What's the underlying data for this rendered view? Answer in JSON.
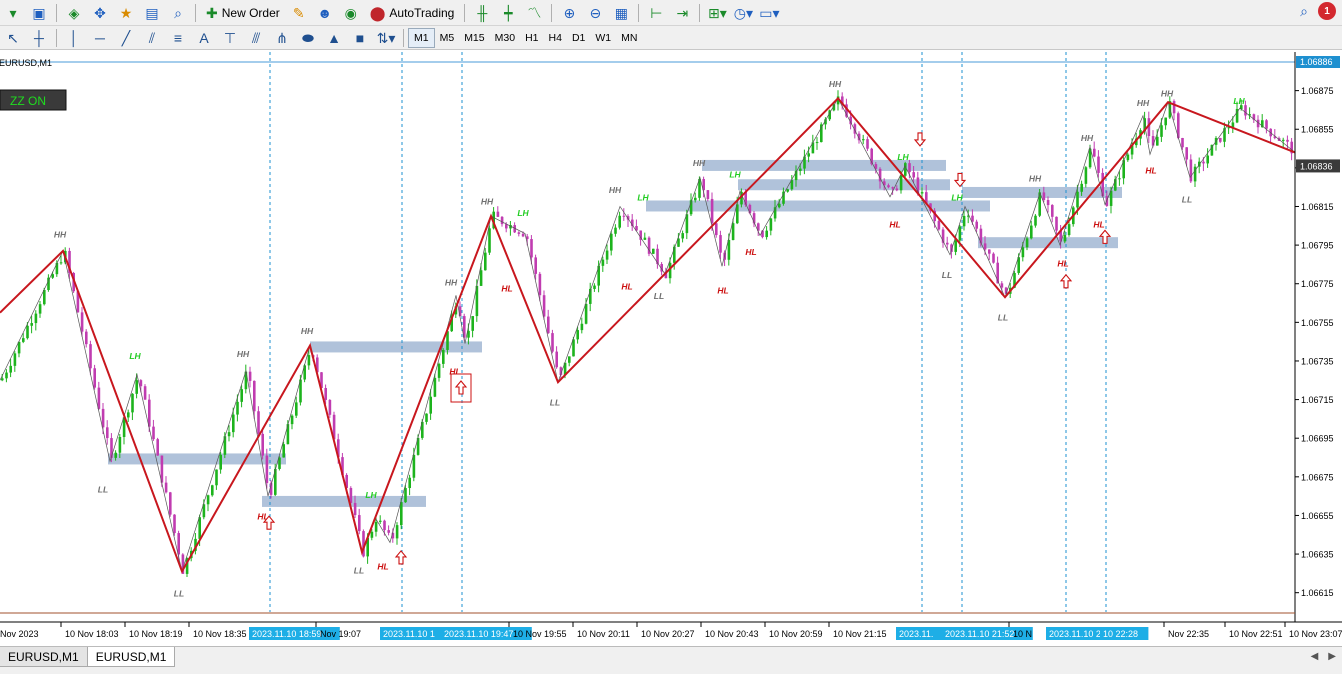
{
  "toolbar": {
    "new_order_label": "New Order",
    "autotrading_label": "AutoTrading",
    "timeframes": [
      "M1",
      "M5",
      "M15",
      "M30",
      "H1",
      "H4",
      "D1",
      "W1",
      "MN"
    ],
    "active_timeframe": "M1",
    "notification_count": "1"
  },
  "chart": {
    "symbol_label": "EURUSD,M1",
    "zz_button_label": "ZZ ON",
    "current_price_label": "1.06836",
    "top_price_label": "1.06886",
    "colors": {
      "bull": "#1db31d",
      "bear": "#c03cb0",
      "zigzag": "#c8171e",
      "zone": "#a7bbd6",
      "vline": "#1e90d0",
      "hh": "#707070",
      "lh": "#22cc22",
      "hl": "#cc1111",
      "ll": "#707070"
    }
  },
  "chart_data": {
    "type": "line",
    "price_scale": {
      "min": 1.06605,
      "max": 1.06895,
      "ticks": [
        "1.06875",
        "1.06855",
        "1.06835",
        "1.06815",
        "1.06795",
        "1.06775",
        "1.06755",
        "1.06735",
        "1.06715",
        "1.06695",
        "1.06675",
        "1.06655",
        "1.06635",
        "1.06615"
      ]
    },
    "time_labels": [
      {
        "text": "Nov 2023",
        "highlighted": false,
        "i": 0
      },
      {
        "text": "10 Nov 18:03",
        "highlighted": false,
        "i": 65
      },
      {
        "text": "10 Nov 18:19",
        "highlighted": false,
        "i": 129
      },
      {
        "text": "10 Nov 18:35",
        "highlighted": false,
        "i": 193
      },
      {
        "text": "2023.11.10 18:59",
        "highlighted": true,
        "i": 252
      },
      {
        "text": "Nov 19:07",
        "highlighted": false,
        "i": 320
      },
      {
        "text": "2023.11.10 1",
        "highlighted": true,
        "i": 383
      },
      {
        "text": "2023.11.10 19:47",
        "highlighted": true,
        "i": 444
      },
      {
        "text": "10 Nov 19:55",
        "highlighted": false,
        "i": 513
      },
      {
        "text": "10 Nov 20:11",
        "highlighted": false,
        "i": 577
      },
      {
        "text": "10 Nov 20:27",
        "highlighted": false,
        "i": 641
      },
      {
        "text": "10 Nov 20:43",
        "highlighted": false,
        "i": 705
      },
      {
        "text": "10 Nov 20:59",
        "highlighted": false,
        "i": 769
      },
      {
        "text": "10 Nov 21:15",
        "highlighted": false,
        "i": 833
      },
      {
        "text": "2023.11.",
        "highlighted": true,
        "i": 899
      },
      {
        "text": "2023.11.10 21:52",
        "highlighted": true,
        "i": 945
      },
      {
        "text": "10 N",
        "highlighted": false,
        "i": 1013
      },
      {
        "text": "2023.11.10 22:18",
        "highlighted": true,
        "i": 1049
      },
      {
        "text": "10 22:28",
        "highlighted": true,
        "i": 1103
      },
      {
        "text": "Nov 22:35",
        "highlighted": false,
        "i": 1168
      },
      {
        "text": "10 Nov 22:51",
        "highlighted": false,
        "i": 1229
      },
      {
        "text": "10 Nov 23:07",
        "highlighted": false,
        "i": 1289
      }
    ],
    "zigzag_main": [
      {
        "i": 0,
        "p": 1.0676
      },
      {
        "i": 63,
        "p": 1.06792
      },
      {
        "i": 182,
        "p": 1.06626
      },
      {
        "i": 310,
        "p": 1.06743
      },
      {
        "i": 362,
        "p": 1.06636
      },
      {
        "i": 491,
        "p": 1.0681
      },
      {
        "i": 558,
        "p": 1.06724
      },
      {
        "i": 838,
        "p": 1.06871
      },
      {
        "i": 1005,
        "p": 1.06768
      },
      {
        "i": 1168,
        "p": 1.06869
      },
      {
        "i": 1295,
        "p": 1.06843
      }
    ],
    "zigzag_minor": [
      {
        "i": 0,
        "p": 1.06725
      },
      {
        "i": 63,
        "p": 1.06792
      },
      {
        "i": 110,
        "p": 1.06683
      },
      {
        "i": 137,
        "p": 1.06728
      },
      {
        "i": 182,
        "p": 1.06626
      },
      {
        "i": 246,
        "p": 1.0673
      },
      {
        "i": 268,
        "p": 1.06665
      },
      {
        "i": 310,
        "p": 1.06743
      },
      {
        "i": 362,
        "p": 1.06636
      },
      {
        "i": 375,
        "p": 1.06654
      },
      {
        "i": 390,
        "p": 1.06641
      },
      {
        "i": 456,
        "p": 1.06769
      },
      {
        "i": 465,
        "p": 1.06744
      },
      {
        "i": 491,
        "p": 1.0681
      },
      {
        "i": 525,
        "p": 1.06801
      },
      {
        "i": 558,
        "p": 1.06724
      },
      {
        "i": 620,
        "p": 1.06815
      },
      {
        "i": 665,
        "p": 1.0678
      },
      {
        "i": 700,
        "p": 1.0683
      },
      {
        "i": 722,
        "p": 1.06784
      },
      {
        "i": 740,
        "p": 1.06823
      },
      {
        "i": 760,
        "p": 1.068
      },
      {
        "i": 838,
        "p": 1.06871
      },
      {
        "i": 890,
        "p": 1.0682
      },
      {
        "i": 905,
        "p": 1.06836
      },
      {
        "i": 950,
        "p": 1.0679
      },
      {
        "i": 965,
        "p": 1.06815
      },
      {
        "i": 1005,
        "p": 1.06768
      },
      {
        "i": 1040,
        "p": 1.06822
      },
      {
        "i": 1060,
        "p": 1.06795
      },
      {
        "i": 1090,
        "p": 1.06846
      },
      {
        "i": 1105,
        "p": 1.06816
      },
      {
        "i": 1143,
        "p": 1.06862
      },
      {
        "i": 1150,
        "p": 1.06842
      },
      {
        "i": 1168,
        "p": 1.06869
      },
      {
        "i": 1190,
        "p": 1.0683
      },
      {
        "i": 1240,
        "p": 1.06866
      },
      {
        "i": 1295,
        "p": 1.06843
      }
    ],
    "pivot_labels": [
      {
        "text": "HH",
        "kind": "hh",
        "i": 60,
        "p": 1.06799
      },
      {
        "text": "LH",
        "kind": "lh",
        "i": 135,
        "p": 1.06736
      },
      {
        "text": "LL",
        "kind": "ll",
        "i": 103,
        "p": 1.06667
      },
      {
        "text": "HH",
        "kind": "hh",
        "i": 243,
        "p": 1.06737
      },
      {
        "text": "HL",
        "kind": "hl",
        "i": 263,
        "p": 1.06653
      },
      {
        "text": "LL",
        "kind": "ll",
        "i": 179,
        "p": 1.06613
      },
      {
        "text": "HH",
        "kind": "hh",
        "i": 307,
        "p": 1.06749
      },
      {
        "text": "LH",
        "kind": "lh",
        "i": 371,
        "p": 1.06664
      },
      {
        "text": "LL",
        "kind": "ll",
        "i": 359,
        "p": 1.06625
      },
      {
        "text": "HL",
        "kind": "hl",
        "i": 383,
        "p": 1.06627
      },
      {
        "text": "HH",
        "kind": "hh",
        "i": 451,
        "p": 1.06774
      },
      {
        "text": "HL",
        "kind": "hl",
        "i": 455,
        "p": 1.06728
      },
      {
        "text": "HH",
        "kind": "hh",
        "i": 487,
        "p": 1.06816
      },
      {
        "text": "LH",
        "kind": "lh",
        "i": 523,
        "p": 1.0681
      },
      {
        "text": "HL",
        "kind": "hl",
        "i": 507,
        "p": 1.06771
      },
      {
        "text": "LL",
        "kind": "ll",
        "i": 555,
        "p": 1.06712
      },
      {
        "text": "HH",
        "kind": "hh",
        "i": 615,
        "p": 1.06822
      },
      {
        "text": "LH",
        "kind": "lh",
        "i": 643,
        "p": 1.06818
      },
      {
        "text": "HL",
        "kind": "hl",
        "i": 627,
        "p": 1.06772
      },
      {
        "text": "LL",
        "kind": "ll",
        "i": 659,
        "p": 1.06767
      },
      {
        "text": "HH",
        "kind": "hh",
        "i": 699,
        "p": 1.06836
      },
      {
        "text": "LH",
        "kind": "lh",
        "i": 735,
        "p": 1.0683
      },
      {
        "text": "HL",
        "kind": "hl",
        "i": 723,
        "p": 1.0677
      },
      {
        "text": "HL",
        "kind": "hl",
        "i": 751,
        "p": 1.0679
      },
      {
        "text": "HH",
        "kind": "hh",
        "i": 835,
        "p": 1.06877
      },
      {
        "text": "LH",
        "kind": "lh",
        "i": 903,
        "p": 1.06839
      },
      {
        "text": "HL",
        "kind": "hl",
        "i": 895,
        "p": 1.06804
      },
      {
        "text": "LH",
        "kind": "lh",
        "i": 957,
        "p": 1.06818
      },
      {
        "text": "LL",
        "kind": "ll",
        "i": 947,
        "p": 1.06778
      },
      {
        "text": "LL",
        "kind": "ll",
        "i": 1003,
        "p": 1.06756
      },
      {
        "text": "HH",
        "kind": "hh",
        "i": 1035,
        "p": 1.06828
      },
      {
        "text": "HL",
        "kind": "hl",
        "i": 1063,
        "p": 1.06784
      },
      {
        "text": "HH",
        "kind": "hh",
        "i": 1087,
        "p": 1.06849
      },
      {
        "text": "HL",
        "kind": "hl",
        "i": 1099,
        "p": 1.06804
      },
      {
        "text": "HL",
        "kind": "hl",
        "i": 1151,
        "p": 1.06832
      },
      {
        "text": "HH",
        "kind": "hh",
        "i": 1143,
        "p": 1.06867
      },
      {
        "text": "HH",
        "kind": "hh",
        "i": 1167,
        "p": 1.06872
      },
      {
        "text": "LL",
        "kind": "ll",
        "i": 1187,
        "p": 1.06817
      },
      {
        "text": "LH",
        "kind": "lh",
        "i": 1239,
        "p": 1.06868
      }
    ],
    "zones": [
      {
        "i0": 108,
        "i1": 286,
        "p": 1.06684
      },
      {
        "i0": 262,
        "i1": 426,
        "p": 1.06662
      },
      {
        "i0": 310,
        "i1": 482,
        "p": 1.06742
      },
      {
        "i0": 702,
        "i1": 946,
        "p": 1.06836
      },
      {
        "i0": 738,
        "i1": 950,
        "p": 1.06826
      },
      {
        "i0": 646,
        "i1": 990,
        "p": 1.06815
      },
      {
        "i0": 962,
        "i1": 1122,
        "p": 1.06822
      },
      {
        "i0": 978,
        "i1": 1118,
        "p": 1.06796
      }
    ],
    "vlines": [
      270,
      402,
      462,
      922,
      962,
      1066,
      1106
    ],
    "arrows": [
      {
        "dir": "up",
        "i": 269,
        "p": 1.06651,
        "boxed": false
      },
      {
        "dir": "up",
        "i": 401,
        "p": 1.06633,
        "boxed": false
      },
      {
        "dir": "up",
        "i": 461,
        "p": 1.06721,
        "boxed": true
      },
      {
        "dir": "down",
        "i": 920,
        "p": 1.0685,
        "boxed": false
      },
      {
        "dir": "down",
        "i": 960,
        "p": 1.06829,
        "boxed": false
      },
      {
        "dir": "up",
        "i": 1066,
        "p": 1.06776,
        "boxed": false
      },
      {
        "dir": "up",
        "i": 1105,
        "p": 1.06799,
        "boxed": false
      }
    ]
  },
  "tabs": [
    {
      "label": "EURUSD,M1",
      "active": false
    },
    {
      "label": "EURUSD,M1",
      "active": true
    }
  ]
}
